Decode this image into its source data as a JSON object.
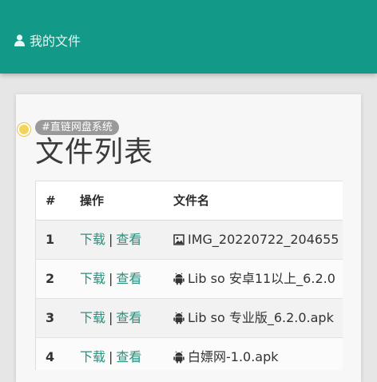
{
  "appbar": {
    "title": "我的文件",
    "user_icon": "user-icon"
  },
  "card": {
    "tag": "#直链网盘系统",
    "heading": "文件列表",
    "table": {
      "headers": {
        "num": "#",
        "ops": "操作",
        "name": "文件名"
      },
      "actions": {
        "download": "下载",
        "separator": "|",
        "view": "查看"
      },
      "rows": [
        {
          "num": "1",
          "icon": "image-icon",
          "name": "IMG_20220722_204655"
        },
        {
          "num": "2",
          "icon": "android-icon",
          "name": "Lib so 安卓11以上_6.2.0"
        },
        {
          "num": "3",
          "icon": "android-icon",
          "name": "Lib so 专业版_6.2.0.apk"
        },
        {
          "num": "4",
          "icon": "android-icon",
          "name": "白嫖网-1.0.apk"
        }
      ]
    }
  },
  "colors": {
    "appbar": "#129987",
    "link": "#2e8f7d",
    "tag": "#9a9a9a",
    "dot": "#f3d35a"
  }
}
